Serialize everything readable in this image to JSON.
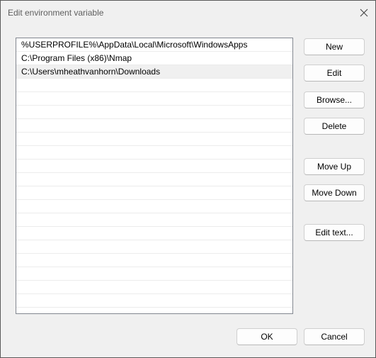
{
  "window": {
    "title": "Edit environment variable",
    "close_icon": "close-icon"
  },
  "list": {
    "rows": [
      "%USERPROFILE%\\AppData\\Local\\Microsoft\\WindowsApps",
      "C:\\Program Files (x86)\\Nmap",
      "C:\\Users\\mheathvanhorn\\Downloads",
      "",
      "",
      "",
      "",
      "",
      "",
      "",
      "",
      "",
      "",
      "",
      "",
      "",
      "",
      "",
      "",
      "",
      ""
    ],
    "selected_index": 2
  },
  "buttons": {
    "new": "New",
    "edit": "Edit",
    "browse": "Browse...",
    "delete": "Delete",
    "move_up": "Move Up",
    "move_down": "Move Down",
    "edit_text": "Edit text...",
    "ok": "OK",
    "cancel": "Cancel"
  },
  "colors": {
    "dialog_bg": "#f0f0f0",
    "selected_row_bg": "#f0f0f0",
    "list_border": "#828790"
  }
}
